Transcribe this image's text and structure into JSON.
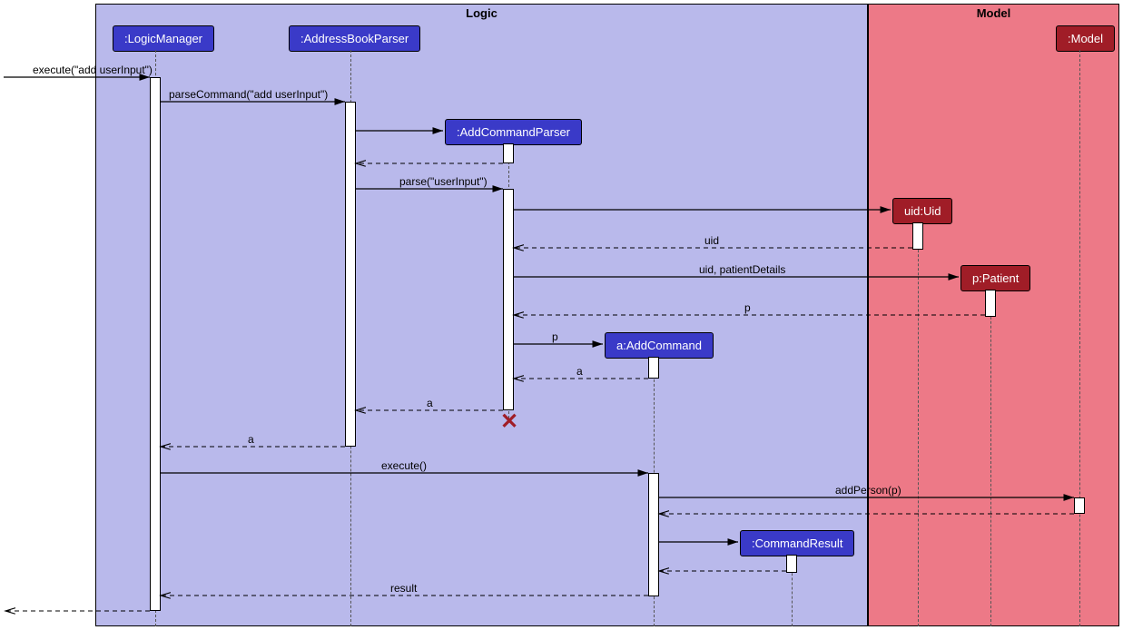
{
  "frames": {
    "logic": "Logic",
    "model": "Model"
  },
  "participants": {
    "logicManager": ":LogicManager",
    "addressBookParser": ":AddressBookParser",
    "addCommandParser": ":AddCommandParser",
    "uid": "uid:Uid",
    "patient": "p:Patient",
    "addCommand": "a:AddCommand",
    "commandResult": ":CommandResult",
    "model": ":Model"
  },
  "messages": {
    "m1": "execute(\"add userInput\")",
    "m2": "parseCommand(\"add userInput\")",
    "m3": "parse(\"userInput\")",
    "m4": "uid",
    "m5": "uid, patientDetails",
    "m6": "p",
    "m7": "p",
    "m8": "a",
    "m9": "a",
    "m10": "a",
    "m11": "execute()",
    "m12": "addPerson(p)",
    "m13": "result"
  },
  "chart_data": {
    "type": "uml-sequence",
    "frames": [
      {
        "name": "Logic",
        "participants": [
          ":LogicManager",
          ":AddressBookParser",
          ":AddCommandParser",
          "a:AddCommand",
          ":CommandResult"
        ]
      },
      {
        "name": "Model",
        "participants": [
          "uid:Uid",
          "p:Patient",
          ":Model"
        ]
      }
    ],
    "participants": [
      ":LogicManager",
      ":AddressBookParser",
      ":AddCommandParser",
      "uid:Uid",
      "p:Patient",
      "a:AddCommand",
      ":CommandResult",
      ":Model"
    ],
    "messages": [
      {
        "from": "external",
        "to": ":LogicManager",
        "label": "execute(\"add userInput\")",
        "type": "sync"
      },
      {
        "from": ":LogicManager",
        "to": ":AddressBookParser",
        "label": "parseCommand(\"add userInput\")",
        "type": "sync"
      },
      {
        "from": ":AddressBookParser",
        "to": ":AddCommandParser",
        "label": "",
        "type": "create"
      },
      {
        "from": ":AddCommandParser",
        "to": ":AddressBookParser",
        "label": "",
        "type": "return"
      },
      {
        "from": ":AddressBookParser",
        "to": ":AddCommandParser",
        "label": "parse(\"userInput\")",
        "type": "sync"
      },
      {
        "from": ":AddCommandParser",
        "to": "uid:Uid",
        "label": "",
        "type": "create"
      },
      {
        "from": "uid:Uid",
        "to": ":AddCommandParser",
        "label": "uid",
        "type": "return"
      },
      {
        "from": ":AddCommandParser",
        "to": "p:Patient",
        "label": "uid, patientDetails",
        "type": "create"
      },
      {
        "from": "p:Patient",
        "to": ":AddCommandParser",
        "label": "p",
        "type": "return"
      },
      {
        "from": ":AddCommandParser",
        "to": "a:AddCommand",
        "label": "p",
        "type": "create"
      },
      {
        "from": "a:AddCommand",
        "to": ":AddCommandParser",
        "label": "a",
        "type": "return"
      },
      {
        "from": ":AddCommandParser",
        "to": ":AddressBookParser",
        "label": "a",
        "type": "return"
      },
      {
        "from": ":AddCommandParser",
        "to": "destroyed",
        "label": "",
        "type": "destroy"
      },
      {
        "from": ":AddressBookParser",
        "to": ":LogicManager",
        "label": "a",
        "type": "return"
      },
      {
        "from": ":LogicManager",
        "to": "a:AddCommand",
        "label": "execute()",
        "type": "sync"
      },
      {
        "from": "a:AddCommand",
        "to": ":Model",
        "label": "addPerson(p)",
        "type": "sync"
      },
      {
        "from": ":Model",
        "to": "a:AddCommand",
        "label": "",
        "type": "return"
      },
      {
        "from": "a:AddCommand",
        "to": ":CommandResult",
        "label": "",
        "type": "create"
      },
      {
        "from": ":CommandResult",
        "to": "a:AddCommand",
        "label": "",
        "type": "return"
      },
      {
        "from": "a:AddCommand",
        "to": ":LogicManager",
        "label": "result",
        "type": "return"
      },
      {
        "from": ":LogicManager",
        "to": "external",
        "label": "",
        "type": "return"
      }
    ]
  }
}
